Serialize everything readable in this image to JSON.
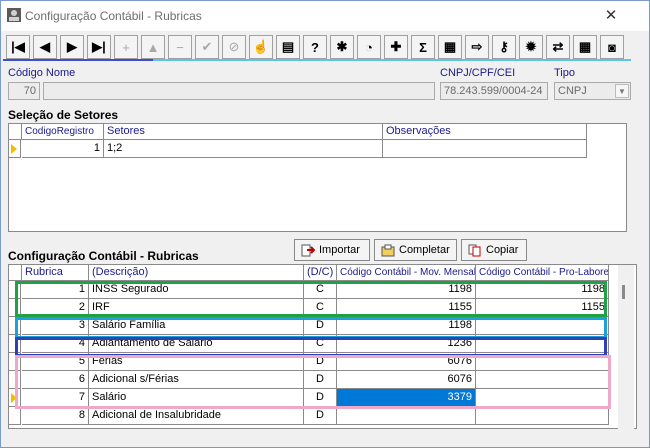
{
  "window": {
    "title": "Configuração Contábil - Rubricas",
    "close_glyph": "✕"
  },
  "toolbar": {
    "buttons": [
      {
        "name": "first-record-button",
        "glyph": "|◀",
        "enabled": true
      },
      {
        "name": "prev-record-button",
        "glyph": "◀",
        "enabled": true
      },
      {
        "name": "next-record-button",
        "glyph": "▶",
        "enabled": true
      },
      {
        "name": "last-record-button",
        "glyph": "▶|",
        "enabled": true
      },
      {
        "name": "insert-button",
        "glyph": "+",
        "enabled": false
      },
      {
        "name": "edit-button",
        "glyph": "▲",
        "enabled": false
      },
      {
        "name": "delete-button",
        "glyph": "−",
        "enabled": false
      },
      {
        "name": "post-button",
        "glyph": "✔",
        "enabled": false
      },
      {
        "name": "cancel-button",
        "glyph": "⊘",
        "enabled": false
      },
      {
        "name": "hand-button",
        "glyph": "☝",
        "enabled": true
      },
      {
        "name": "open-folder-button",
        "glyph": "▤",
        "enabled": true
      },
      {
        "name": "query-button",
        "glyph": "?",
        "enabled": true
      },
      {
        "name": "tools-button",
        "glyph": "✱",
        "enabled": true
      },
      {
        "name": "calculate-button",
        "glyph": "◔",
        "enabled": true
      },
      {
        "name": "wizard-button",
        "glyph": "✚",
        "enabled": true
      },
      {
        "name": "sum-button",
        "glyph": "Σ",
        "enabled": true
      },
      {
        "name": "print-button",
        "glyph": "▦",
        "enabled": true
      },
      {
        "name": "export-button",
        "glyph": "⇨",
        "enabled": true
      },
      {
        "name": "key-button",
        "glyph": "⚷",
        "enabled": true
      },
      {
        "name": "filter-button",
        "glyph": "✹",
        "enabled": true
      },
      {
        "name": "transfer-button",
        "glyph": "⇄",
        "enabled": true
      },
      {
        "name": "calendar-button",
        "glyph": "▦",
        "enabled": true
      },
      {
        "name": "exit-button",
        "glyph": "◙",
        "enabled": true
      }
    ]
  },
  "header": {
    "codigo_nome_label": "Código Nome",
    "codigo_value": "70",
    "nome_value": "",
    "cnpj_label": "CNPJ/CPF/CEI",
    "cnpj_value": "78.243.599/0004-24",
    "tipo_label": "Tipo",
    "tipo_value": "CNPJ"
  },
  "setores": {
    "title": "Seleção de Setores",
    "columns": [
      "CodigoRegistro",
      "Setores",
      "Observações"
    ],
    "rows": [
      {
        "codigo": "1",
        "setores": "1;2",
        "obs": ""
      }
    ]
  },
  "rubricas": {
    "title": "Configuração Contábil - Rubricas",
    "buttons": {
      "importar": "Importar",
      "completar": "Completar",
      "copiar": "Copiar"
    },
    "columns": [
      "Rubrica",
      "(Descrição)",
      "(D/C)",
      "Código Contábil - Mov. Mensal",
      "Código Contábil - Pro-Labore"
    ],
    "rows": [
      {
        "rubrica": "1",
        "descricao": "INSS Segurado",
        "dc": "C",
        "mov": "1198",
        "pro": "1198"
      },
      {
        "rubrica": "2",
        "descricao": "IRF",
        "dc": "C",
        "mov": "1155",
        "pro": "1155"
      },
      {
        "rubrica": "3",
        "descricao": "Salário Família",
        "dc": "D",
        "mov": "1198",
        "pro": ""
      },
      {
        "rubrica": "4",
        "descricao": "Adiantamento de Salário",
        "dc": "C",
        "mov": "1236",
        "pro": ""
      },
      {
        "rubrica": "5",
        "descricao": "Férias",
        "dc": "D",
        "mov": "6076",
        "pro": ""
      },
      {
        "rubrica": "6",
        "descricao": "Adicional s/Férias",
        "dc": "D",
        "mov": "6076",
        "pro": ""
      },
      {
        "rubrica": "7",
        "descricao": "Salário",
        "dc": "D",
        "mov": "3379",
        "pro": ""
      },
      {
        "rubrica": "8",
        "descricao": "Adicional de Insalubridade",
        "dc": "D",
        "mov": "",
        "pro": ""
      }
    ]
  },
  "highlights": {
    "green": "#22a045",
    "cyan": "#1ea0d8",
    "blue": "#3040b8",
    "pink": "#f0a8c8"
  }
}
